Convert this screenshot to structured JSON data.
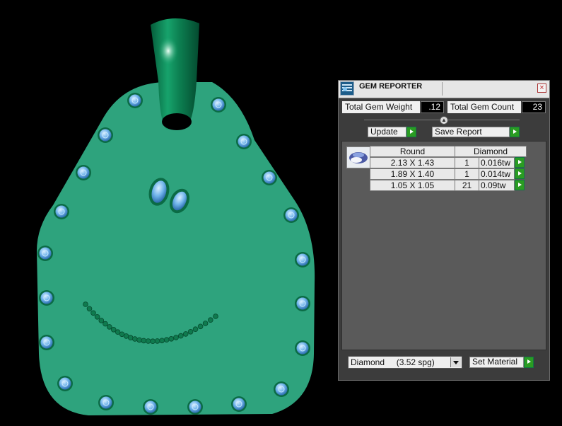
{
  "panel": {
    "title": "GEM REPORTER",
    "close_glyph": "×",
    "icon": "gem-reporter-icon",
    "total_gem_weight_label": "Total Gem Weight",
    "total_gem_weight_value": ".12",
    "total_gem_count_label": "Total Gem Count",
    "total_gem_count_value": "23",
    "update_label": "Update",
    "save_report_label": "Save Report",
    "table": {
      "headers": [
        "Round",
        "Diamond"
      ],
      "rows": [
        {
          "size": "2.13 X 1.43",
          "count": "1",
          "weight": "0.016tw"
        },
        {
          "size": "1.89 X 1.40",
          "count": "1",
          "weight": "0.014tw"
        },
        {
          "size": "1.05 X 1.05",
          "count": "21",
          "weight": "0.09tw"
        }
      ]
    },
    "material_select": {
      "name": "Diamond",
      "spec": "(3.52 spg)"
    },
    "set_material_label": "Set Material"
  },
  "viewport": {
    "pendant_color": "#2ea37d",
    "bail_color": "#0d7a50",
    "gem_color": "#6fb3ea",
    "accent_green": "#2a9c22"
  }
}
